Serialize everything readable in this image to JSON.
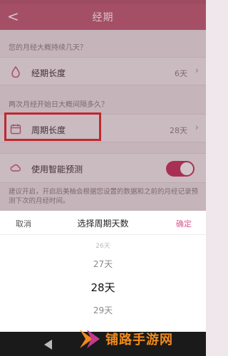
{
  "header": {
    "back_label": "<",
    "title": "经期"
  },
  "sections": {
    "q1": "您的月经大概持续几天？",
    "q2": "两次月经开始日大概间隔多久？"
  },
  "rows": {
    "period_length": {
      "label": "经期长度",
      "value": "6天",
      "icon": "drop-icon"
    },
    "cycle_length": {
      "label": "周期长度",
      "value": "28天",
      "icon": "calendar-icon"
    },
    "smart_predict": {
      "label": "使用智能预测",
      "icon": "cloud-icon",
      "enabled": true
    }
  },
  "tip": "建议开启，开启后美柚会根据您设置的数据和之前的月经记录预测下次的月经时间。",
  "sheet": {
    "cancel": "取消",
    "title": "选择周期天数",
    "confirm": "确定",
    "options": [
      "26天",
      "27天",
      "28天",
      "29天"
    ],
    "selected": "28天"
  },
  "watermark": {
    "text": "铺路手游网"
  },
  "colors": {
    "primary": "#c25b76",
    "accent": "#d95b8e",
    "highlight": "#e8242a",
    "watermark": "#f08a1c"
  }
}
